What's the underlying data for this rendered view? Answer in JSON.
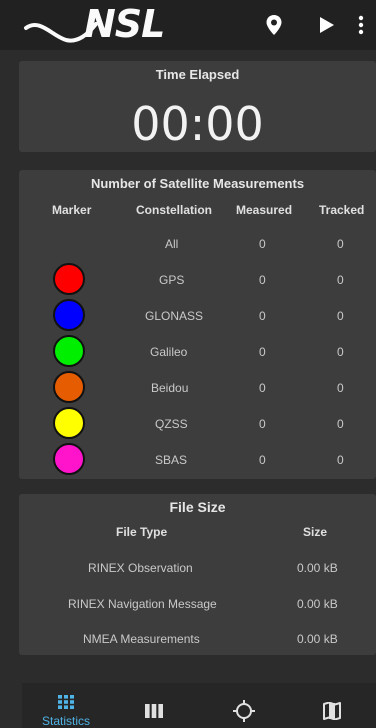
{
  "app": {
    "logo_text": "NSL"
  },
  "time_card": {
    "title": "Time Elapsed",
    "value": "00:00"
  },
  "satellite_card": {
    "title": "Number of Satellite Measurements",
    "headers": {
      "marker": "Marker",
      "constellation": "Constellation",
      "measured": "Measured",
      "tracked": "Tracked"
    },
    "rows": [
      {
        "name": "All",
        "measured": "0",
        "tracked": "0",
        "color": ""
      },
      {
        "name": "GPS",
        "measured": "0",
        "tracked": "0",
        "color": "#ff0000"
      },
      {
        "name": "GLONASS",
        "measured": "0",
        "tracked": "0",
        "color": "#0000ff"
      },
      {
        "name": "Galileo",
        "measured": "0",
        "tracked": "0",
        "color": "#00ee00"
      },
      {
        "name": "Beidou",
        "measured": "0",
        "tracked": "0",
        "color": "#e65c00"
      },
      {
        "name": "QZSS",
        "measured": "0",
        "tracked": "0",
        "color": "#ffff00"
      },
      {
        "name": "SBAS",
        "measured": "0",
        "tracked": "0",
        "color": "#ff14cc"
      }
    ]
  },
  "file_card": {
    "title": "File Size",
    "headers": {
      "type": "File Type",
      "size": "Size"
    },
    "rows": [
      {
        "type": "RINEX Observation",
        "size": "0.00 kB"
      },
      {
        "type": "RINEX Navigation Message",
        "size": "0.00 kB"
      },
      {
        "type": "NMEA Measurements",
        "size": "0.00 kB"
      }
    ]
  },
  "bottom_nav": {
    "active_color": "#4fb3e6",
    "items": [
      {
        "label": "Statistics",
        "icon": "grid-icon"
      },
      {
        "label": "",
        "icon": "columns-icon"
      },
      {
        "label": "",
        "icon": "crosshair-icon"
      },
      {
        "label": "",
        "icon": "map-icon"
      }
    ]
  }
}
